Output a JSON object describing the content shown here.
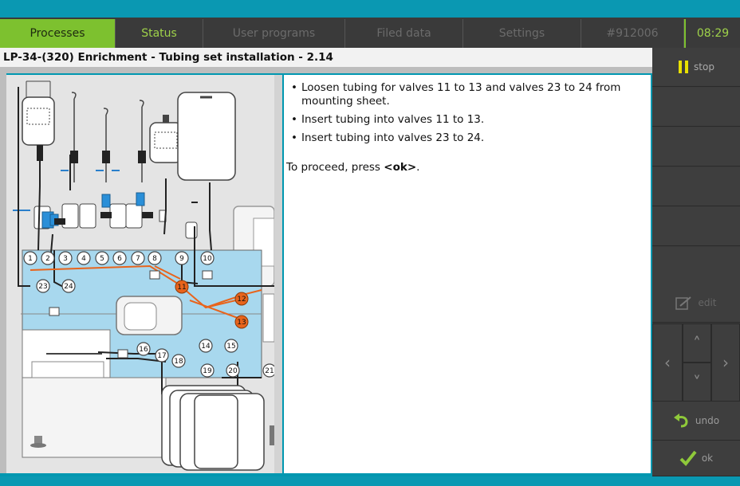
{
  "tabs": [
    {
      "label": "Processes",
      "state": "active"
    },
    {
      "label": "Status",
      "state": "normal"
    },
    {
      "label": "User programs",
      "state": "disabled"
    },
    {
      "label": "Filed data",
      "state": "disabled"
    },
    {
      "label": "Settings",
      "state": "disabled"
    },
    {
      "label": "#912006",
      "state": "disabled"
    },
    {
      "label": "08:29",
      "state": "clock"
    }
  ],
  "page_title": "LP-34-(320) Enrichment - Tubing set installation - 2.14",
  "instructions": [
    "Loosen tubing for valves 11 to 13 and valves 23 to 24 from mounting sheet.",
    "Insert tubing into valves 11 to 13.",
    "Insert tubing into valves 23 to 24."
  ],
  "proceed": {
    "prefix": "To proceed, press ",
    "key": "<ok>",
    "suffix": "."
  },
  "side_buttons": {
    "stop": "stop",
    "edit": "edit",
    "undo": "undo",
    "ok": "ok"
  },
  "valves": {
    "white": [
      "1",
      "2",
      "3",
      "4",
      "5",
      "6",
      "7",
      "8",
      "9",
      "10",
      "14",
      "15",
      "16",
      "17",
      "18",
      "19",
      "20",
      "21",
      "23",
      "24"
    ],
    "orange": [
      "11",
      "12",
      "13"
    ]
  },
  "colors": {
    "accent": "#7dc12f",
    "header": "#0a98b2",
    "valve_highlight": "#e8641c",
    "tray": "#a8d8ee"
  }
}
